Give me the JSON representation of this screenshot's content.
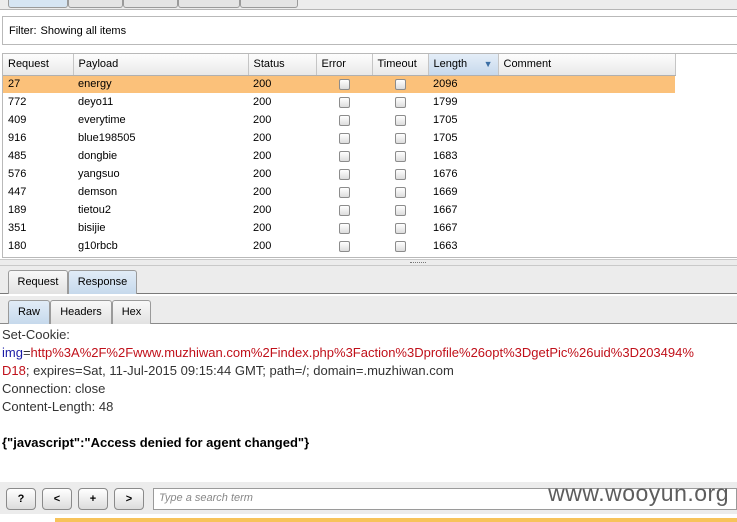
{
  "filter": {
    "label": "Filter:",
    "value": "Showing all items"
  },
  "table": {
    "columns": [
      "Request",
      "Payload",
      "Status",
      "Error",
      "Timeout",
      "Length",
      "Comment"
    ],
    "sorted_column": "Length",
    "rows": [
      {
        "request": "27",
        "payload": "energy",
        "status": "200",
        "length": "2096",
        "selected": true
      },
      {
        "request": "772",
        "payload": "deyo11",
        "status": "200",
        "length": "1799"
      },
      {
        "request": "409",
        "payload": "everytime",
        "status": "200",
        "length": "1705"
      },
      {
        "request": "916",
        "payload": "blue198505",
        "status": "200",
        "length": "1705"
      },
      {
        "request": "485",
        "payload": "dongbie",
        "status": "200",
        "length": "1683"
      },
      {
        "request": "576",
        "payload": "yangsuo",
        "status": "200",
        "length": "1676"
      },
      {
        "request": "447",
        "payload": "demson",
        "status": "200",
        "length": "1669"
      },
      {
        "request": "189",
        "payload": "tietou2",
        "status": "200",
        "length": "1667"
      },
      {
        "request": "351",
        "payload": "bisijie",
        "status": "200",
        "length": "1667"
      },
      {
        "request": "180",
        "payload": "g10rbcb",
        "status": "200",
        "length": "1663"
      }
    ]
  },
  "message_tabs": [
    {
      "label": "Request",
      "active": false
    },
    {
      "label": "Response",
      "active": true
    }
  ],
  "view_tabs": [
    {
      "label": "Raw",
      "active": true
    },
    {
      "label": "Headers",
      "active": false
    },
    {
      "label": "Hex",
      "active": false
    }
  ],
  "response": {
    "line1": "Set-Cookie:",
    "cookie_name": "img",
    "cookie_eq": "=",
    "cookie_value_part1": "http%3A%2F%2Fwww.muzhiwan.com%2Findex.php%3Faction%3Dprofile%26opt%3DgetPic%26uid%3D203494%",
    "cookie_value_part2": "D18",
    "cookie_rest": "; expires=Sat, 11-Jul-2015 09:15:44 GMT; path=/; domain=.muzhiwan.com",
    "connection": "Connection: close",
    "content_length": "Content-Length: 48",
    "body": "{\"javascript\":\"Access denied for agent changed\"}"
  },
  "toolbar": {
    "help_label": "?",
    "prev_label": "<",
    "add_label": "+",
    "next_label": ">",
    "search_placeholder": "Type a search term"
  },
  "watermark": "www.wooyun.org"
}
